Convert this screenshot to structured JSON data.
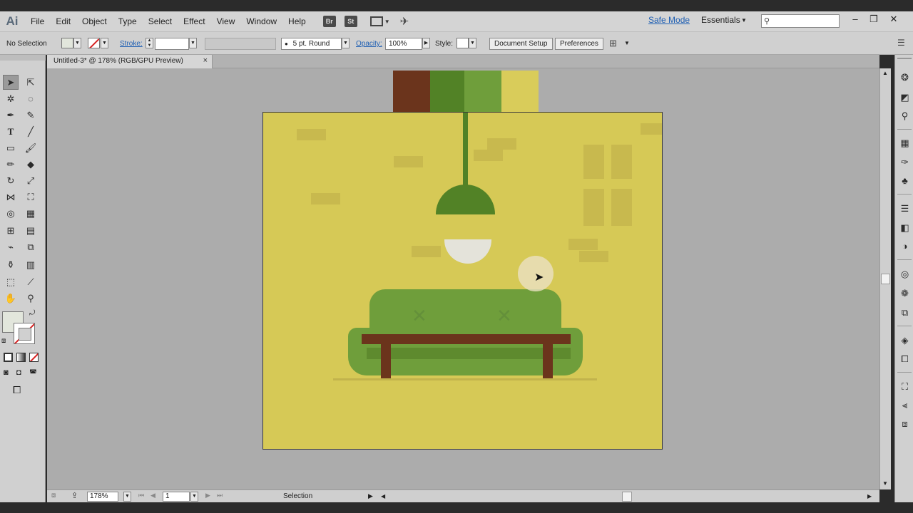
{
  "app": {
    "logo": "Ai"
  },
  "menu": {
    "items": [
      "File",
      "Edit",
      "Object",
      "Type",
      "Select",
      "Effect",
      "View",
      "Window",
      "Help"
    ],
    "bridge_label": "Br",
    "stock_label": "St",
    "safe_mode": "Safe Mode",
    "workspace": "Essentials"
  },
  "control": {
    "selection_label": "No Selection",
    "stroke_label": "Stroke:",
    "brush_label": "5 pt. Round",
    "opacity_label": "Opacity:",
    "opacity_value": "100%",
    "style_label": "Style:",
    "document_setup": "Document Setup",
    "preferences": "Preferences"
  },
  "document": {
    "tab_title": "Untitled-3* @ 178% (RGB/GPU Preview)",
    "tab_close": "×"
  },
  "status": {
    "zoom": "178%",
    "page": "1",
    "tool": "Selection"
  },
  "colors": {
    "artboard": "#d6c956",
    "sofa": "#6f9e3b",
    "lamp": "#528226",
    "table": "#6b341c",
    "brown": "#6b341c",
    "green_dark": "#528226",
    "green_light": "#6f9e3b",
    "yellow": "#d9cc5a",
    "accent_link": "#1f5fb3"
  }
}
